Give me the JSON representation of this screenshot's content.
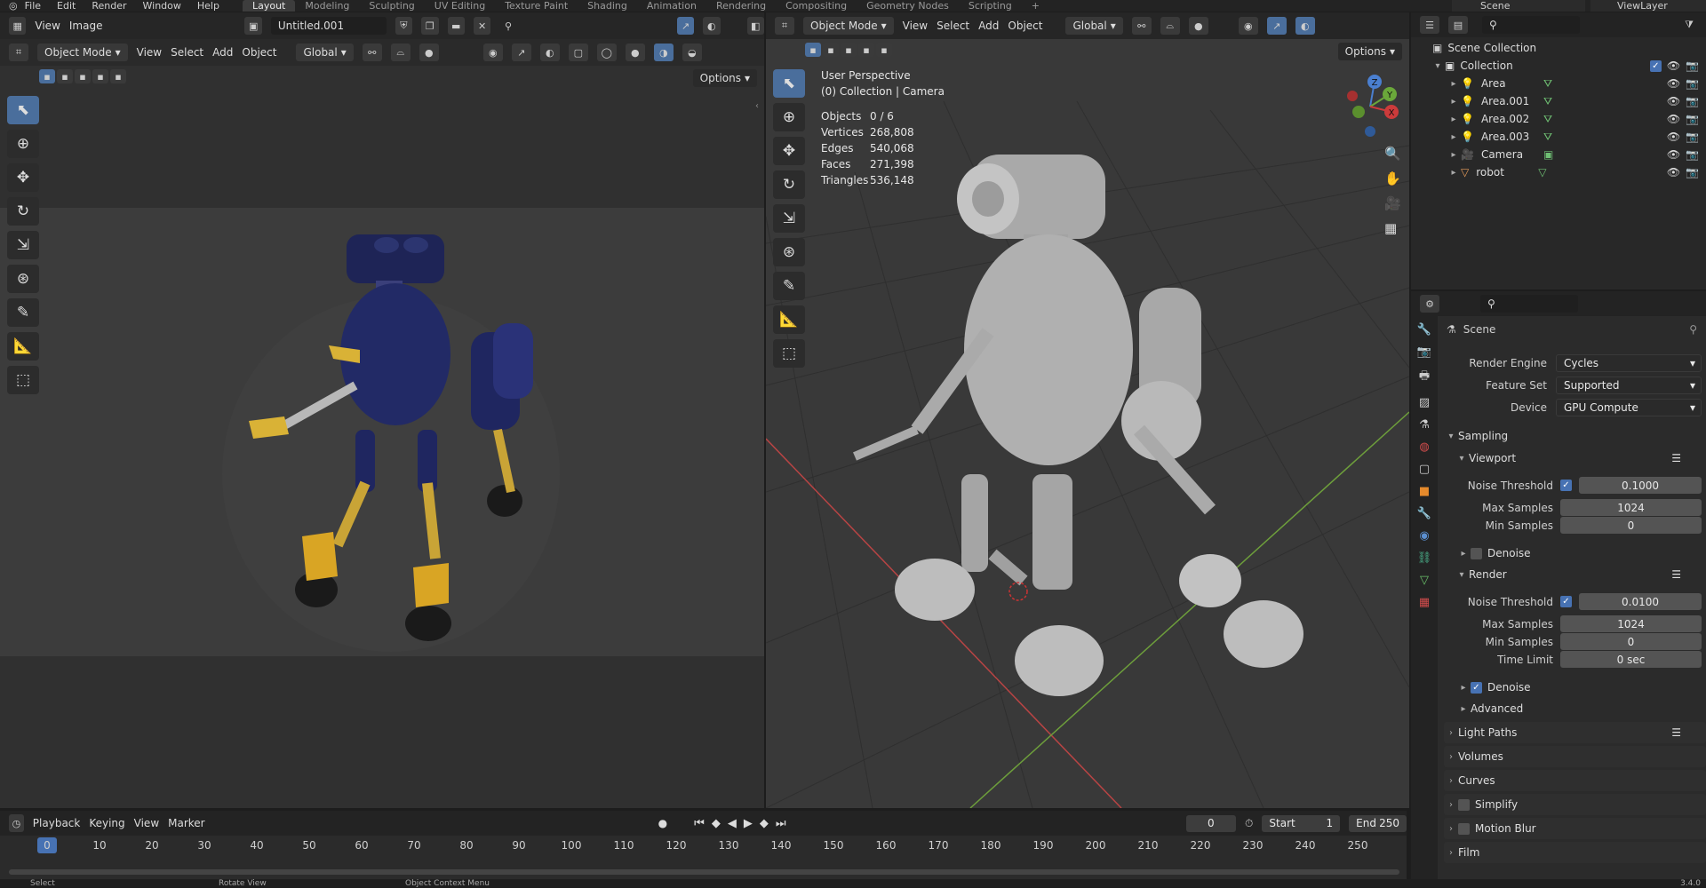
{
  "topbar": {
    "menu": [
      "File",
      "Edit",
      "Render",
      "Window",
      "Help"
    ],
    "workspaces": [
      "Layout",
      "Modeling",
      "Sculpting",
      "UV Editing",
      "Texture Paint",
      "Shading",
      "Animation",
      "Rendering",
      "Compositing",
      "Geometry Nodes",
      "Scripting"
    ],
    "active_workspace": "Layout",
    "scene": "Scene",
    "view_layer": "ViewLayer"
  },
  "image_editor": {
    "view": "View",
    "image": "Image",
    "image_name": "Untitled.001",
    "mode": "Object Mode",
    "menus": [
      "View",
      "Select",
      "Add",
      "Object"
    ],
    "orientation": "Global",
    "options": "Options"
  },
  "viewport": {
    "mode": "Object Mode",
    "menus": [
      "View",
      "Select",
      "Add",
      "Object"
    ],
    "orientation": "Global",
    "options": "Options",
    "perspective": "User Perspective",
    "collection": "(0) Collection | Camera",
    "stats": [
      {
        "k": "Objects",
        "v": "0 / 6"
      },
      {
        "k": "Vertices",
        "v": "268,808"
      },
      {
        "k": "Edges",
        "v": "540,068"
      },
      {
        "k": "Faces",
        "v": "271,398"
      },
      {
        "k": "Triangles",
        "v": "536,148"
      }
    ],
    "gizmo": {
      "z": "Z",
      "y": "Y",
      "x": "X"
    }
  },
  "outliner": {
    "root": "Scene Collection",
    "collection": "Collection",
    "items": [
      "Area",
      "Area.001",
      "Area.002",
      "Area.003",
      "Camera",
      "robot"
    ]
  },
  "properties": {
    "context": "Scene",
    "render_engine_label": "Render Engine",
    "render_engine": "Cycles",
    "feature_set_label": "Feature Set",
    "feature_set": "Supported",
    "device_label": "Device",
    "device": "GPU Compute",
    "sampling": "Sampling",
    "viewport": "Viewport",
    "noise_threshold_label": "Noise Threshold",
    "vp_noise": "0.1000",
    "max_samples_label": "Max Samples",
    "vp_max": "1024",
    "min_samples_label": "Min Samples",
    "vp_min": "0",
    "denoise": "Denoise",
    "render": "Render",
    "r_noise": "0.0100",
    "r_max": "1024",
    "r_min": "0",
    "time_limit_label": "Time Limit",
    "r_time": "0 sec",
    "advanced": "Advanced",
    "sections": [
      "Light Paths",
      "Volumes",
      "Curves",
      "Simplify",
      "Motion Blur",
      "Film"
    ]
  },
  "timeline": {
    "menus": [
      "Playback",
      "Keying",
      "View",
      "Marker"
    ],
    "current": "0",
    "start_label": "Start",
    "start": "1",
    "end_label": "End",
    "end": "250",
    "ticks": [
      "0",
      "10",
      "20",
      "30",
      "40",
      "50",
      "60",
      "70",
      "80",
      "90",
      "100",
      "110",
      "120",
      "130",
      "140",
      "150",
      "160",
      "170",
      "180",
      "190",
      "200",
      "210",
      "220",
      "230",
      "240",
      "250"
    ]
  },
  "statusbar": {
    "select": "Select",
    "rotate": "Rotate View",
    "context": "Object Context Menu",
    "version": "3.4.0"
  }
}
